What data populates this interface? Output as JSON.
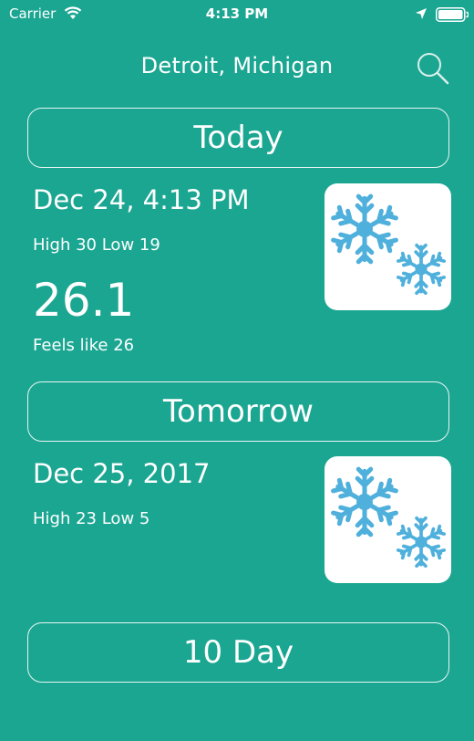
{
  "status_bar": {
    "carrier": "Carrier",
    "time": "4:13 PM"
  },
  "header": {
    "city": "Detroit, Michigan",
    "search_icon": "search-icon"
  },
  "today": {
    "button_label": "Today",
    "date": "Dec 24, 4:13 PM",
    "high_low": "High 30 Low 19",
    "temperature": "26.1",
    "feels_like": "Feels like 26",
    "condition_icon": "snowflake-icon"
  },
  "tomorrow": {
    "button_label": "Tomorrow",
    "date": "Dec 25, 2017",
    "high_low": "High 23 Low 5",
    "condition_icon": "snowflake-icon"
  },
  "ten_day": {
    "button_label": "10 Day"
  },
  "colors": {
    "background": "#1ba692",
    "snowflake": "#4fb0dc"
  }
}
